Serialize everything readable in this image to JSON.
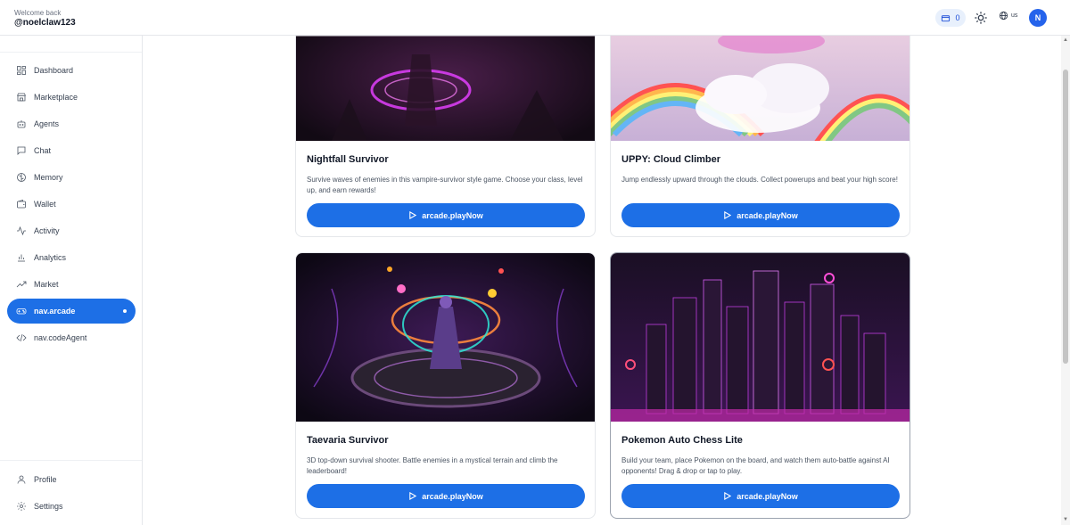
{
  "header": {
    "welcome": "Welcome back",
    "username": "@noelclaw123",
    "wallet_count": "0",
    "lang": "us",
    "avatar_initial": "N"
  },
  "sidebar": {
    "items": [
      {
        "label": "Dashboard",
        "icon": "grid-icon"
      },
      {
        "label": "Marketplace",
        "icon": "store-icon"
      },
      {
        "label": "Agents",
        "icon": "bot-icon"
      },
      {
        "label": "Chat",
        "icon": "chat-icon"
      },
      {
        "label": "Memory",
        "icon": "brain-icon"
      },
      {
        "label": "Wallet",
        "icon": "wallet-icon"
      },
      {
        "label": "Activity",
        "icon": "activity-icon"
      },
      {
        "label": "Analytics",
        "icon": "bar-chart-icon"
      },
      {
        "label": "Market",
        "icon": "trend-icon"
      },
      {
        "label": "nav.arcade",
        "icon": "gamepad-icon",
        "active": true
      },
      {
        "label": "nav.codeAgent",
        "icon": "code-icon"
      }
    ],
    "bottom": [
      {
        "label": "Profile",
        "icon": "user-icon"
      },
      {
        "label": "Settings",
        "icon": "gear-icon"
      }
    ]
  },
  "games": [
    {
      "title": "Nightfall Survivor",
      "description": "Survive waves of enemies in this vampire-survivor style game. Choose your class, level up, and earn rewards!",
      "button": "arcade.playNow"
    },
    {
      "title": "UPPY: Cloud Climber",
      "description": "Jump endlessly upward through the clouds. Collect powerups and beat your high score!",
      "button": "arcade.playNow"
    },
    {
      "title": "Taevaria Survivor",
      "description": "3D top-down survival shooter. Battle enemies in a mystical terrain and climb the leaderboard!",
      "button": "arcade.playNow"
    },
    {
      "title": "Pokemon Auto Chess Lite",
      "description": "Build your team, place Pokemon on the board, and watch them auto-battle against AI opponents! Drag & drop or tap to play.",
      "button": "arcade.playNow"
    }
  ],
  "colors": {
    "accent": "#1d6fe6",
    "sidebar_active": "#1d6fe6",
    "text_primary": "#111827",
    "text_secondary": "#4b5563"
  }
}
